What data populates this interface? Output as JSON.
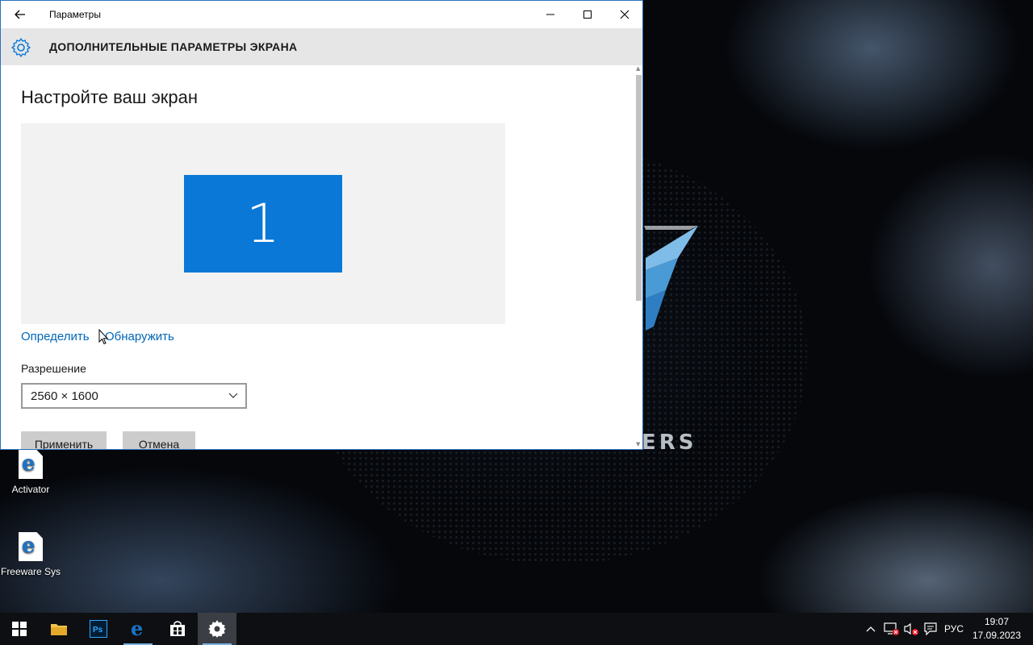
{
  "window": {
    "title": "Параметры",
    "header": "ДОПОЛНИТЕЛЬНЫЕ ПАРАМЕТРЫ ЭКРАНА",
    "page_title": "Настройте ваш экран",
    "monitor_number": "1",
    "identify_link": "Определить",
    "detect_link": "Обнаружить",
    "resolution_label": "Разрешение",
    "resolution_value": "2560 × 1600",
    "apply_button": "Применить",
    "cancel_button": "Отмена"
  },
  "desktop": {
    "icons": [
      {
        "label": "Activator"
      },
      {
        "label": "Freeware Sys"
      }
    ],
    "wallpaper_text": "ERS"
  },
  "taskbar": {
    "items": [
      "start",
      "file-explorer",
      "photoshop",
      "edge",
      "store",
      "settings"
    ],
    "active": "settings",
    "language": "РУС",
    "time": "19:07",
    "date": "17.09.2023"
  },
  "colors": {
    "accent": "#0a78d7",
    "link": "#0067b8",
    "header_bg": "#e6e6e6",
    "taskbar_bg": "#0d0f12"
  }
}
